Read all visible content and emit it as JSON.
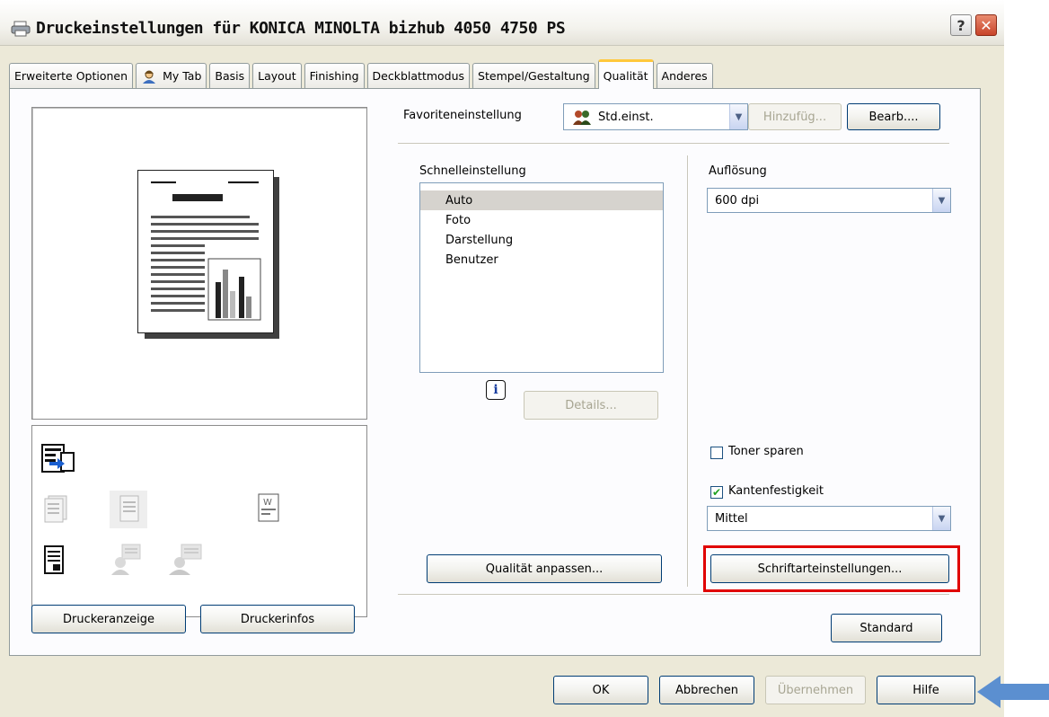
{
  "window": {
    "title": "Druckeinstellungen für KONICA MINOLTA bizhub 4050 4750 PS",
    "help_glyph": "?",
    "close_glyph": "✕"
  },
  "tabs": [
    {
      "label": "Erweiterte Optionen"
    },
    {
      "label": "My Tab",
      "icon": "user-icon"
    },
    {
      "label": "Basis"
    },
    {
      "label": "Layout"
    },
    {
      "label": "Finishing"
    },
    {
      "label": "Deckblattmodus"
    },
    {
      "label": "Stempel/Gestaltung"
    },
    {
      "label": "Qualität",
      "active": true
    },
    {
      "label": "Anderes"
    }
  ],
  "favorites": {
    "label": "Favoriteneinstellung",
    "value": "Std.einst.",
    "add_label": "Hinzufüg...",
    "edit_label": "Bearb...."
  },
  "quick_settings": {
    "label": "Schnelleinstellung",
    "items": [
      {
        "label": "Auto",
        "selected": true
      },
      {
        "label": "Foto"
      },
      {
        "label": "Darstellung"
      },
      {
        "label": "Benutzer"
      }
    ],
    "info_glyph": "i",
    "details_label": "Details..."
  },
  "resolution": {
    "label": "Auflösung",
    "value": "600 dpi"
  },
  "toner_save": {
    "label": "Toner sparen",
    "checked": false
  },
  "edge_enhancement": {
    "label": "Kantenfestigkeit",
    "checked": true,
    "check_glyph": "✔",
    "value": "Mittel"
  },
  "buttons": {
    "adjust_quality": "Qualität anpassen...",
    "font_settings": "Schriftarteinstellungen...",
    "standard": "Standard",
    "printer_view": "Druckeranzeige",
    "printer_info": "Druckerinfos",
    "ok": "OK",
    "cancel": "Abbrechen",
    "apply": "Übernehmen",
    "help": "Hilfe"
  },
  "colors": {
    "highlight_frame": "#e00000",
    "arrow": "#5b8fd0",
    "active_tab_accent": "#ffc83c"
  }
}
